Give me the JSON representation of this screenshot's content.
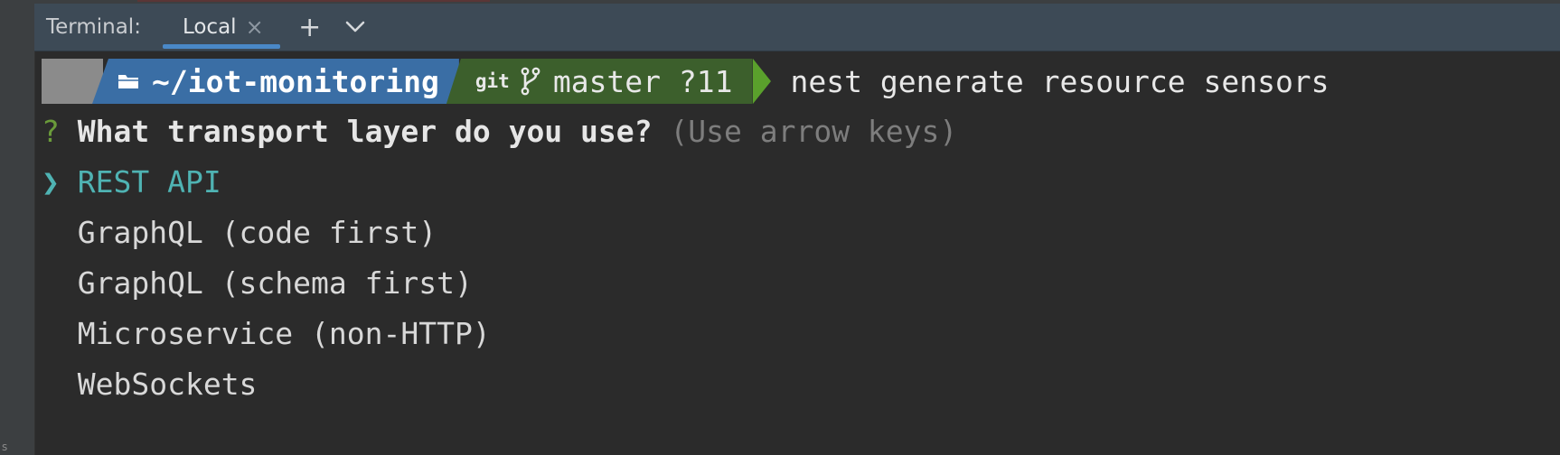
{
  "panel": {
    "title": "Terminal:",
    "active_tab": {
      "label": "Local",
      "close_glyph": "×"
    },
    "new_tab_glyph": "+",
    "dropdown_icon": "chevron-down-icon"
  },
  "prompt": {
    "os_icon": "apple-icon",
    "folder_icon": "folder-icon",
    "directory": "~/iot-monitoring",
    "git_label": "git",
    "branch_icon": "git-branch-icon",
    "branch": "master ?11",
    "command": "nest generate resource sensors"
  },
  "question": {
    "mark": "?",
    "text": "What transport layer do you use?",
    "hint": "(Use arrow keys)"
  },
  "options": {
    "selected_marker": "❯",
    "items": [
      "REST API",
      "GraphQL (code first)",
      "GraphQL (schema first)",
      "Microservice (non-HTTP)",
      "WebSockets"
    ],
    "selected_index": 0
  },
  "colors": {
    "tab_bar": "#3d4a56",
    "terminal_bg": "#2b2b2b",
    "dir_segment": "#3a6ea5",
    "git_segment": "#3c5f2c",
    "selected": "#4fb3b3",
    "question_mark": "#6a9b3a"
  }
}
